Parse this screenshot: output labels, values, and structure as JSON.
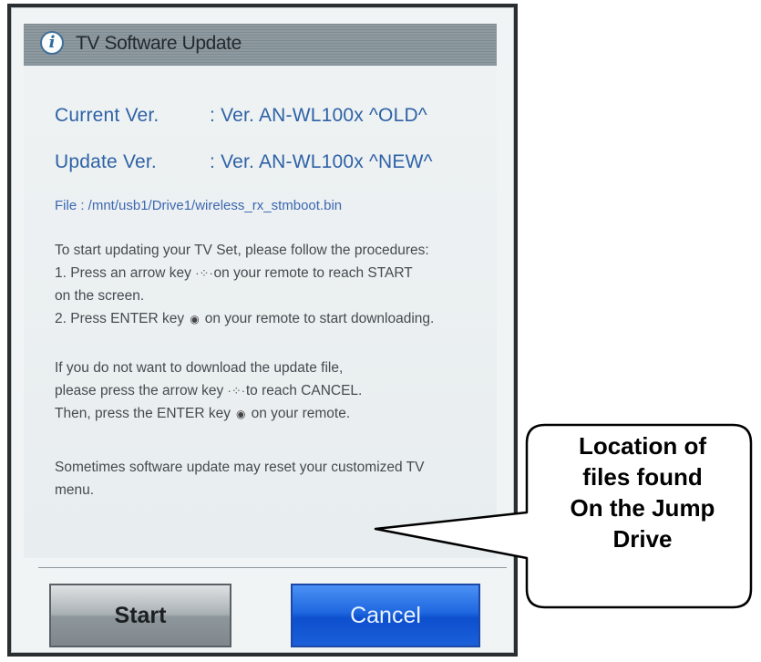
{
  "dialog": {
    "title": "TV Software Update",
    "info_icon": "info-icon",
    "current": {
      "label": "Current Ver.",
      "value": ": Ver. AN-WL100x ^OLD^"
    },
    "update": {
      "label": "Update Ver.",
      "value": ": Ver. AN-WL100x ^NEW^"
    },
    "file": "File : /mnt/usb1/Drive1/wireless_rx_stmboot.bin",
    "instructions": {
      "l1": "To start updating your TV Set, please follow the procedures:",
      "l2a": "1. Press an arrow key",
      "l2b": "on your remote to reach START",
      "l3": "on the screen.",
      "l4a": "2. Press ENTER key",
      "l4b": "on your remote to start downloading."
    },
    "cancel_info": {
      "l1": "If you do not want to download the update file,",
      "l2a": "please press the arrow key",
      "l2b": "to reach CANCEL.",
      "l3a": "Then, press the ENTER key",
      "l3b": "on your remote."
    },
    "warning": {
      "l1": "Sometimes software update may reset your customized TV",
      "l2": "menu."
    },
    "buttons": {
      "start": "Start",
      "cancel": "Cancel"
    },
    "colors": {
      "version_text": "#2f62a6",
      "cancel_button": "#1f67e0",
      "title_bar": "#8e9aa0"
    }
  },
  "callout": {
    "text": "Location of\nfiles found\nOn the Jump\nDrive"
  }
}
